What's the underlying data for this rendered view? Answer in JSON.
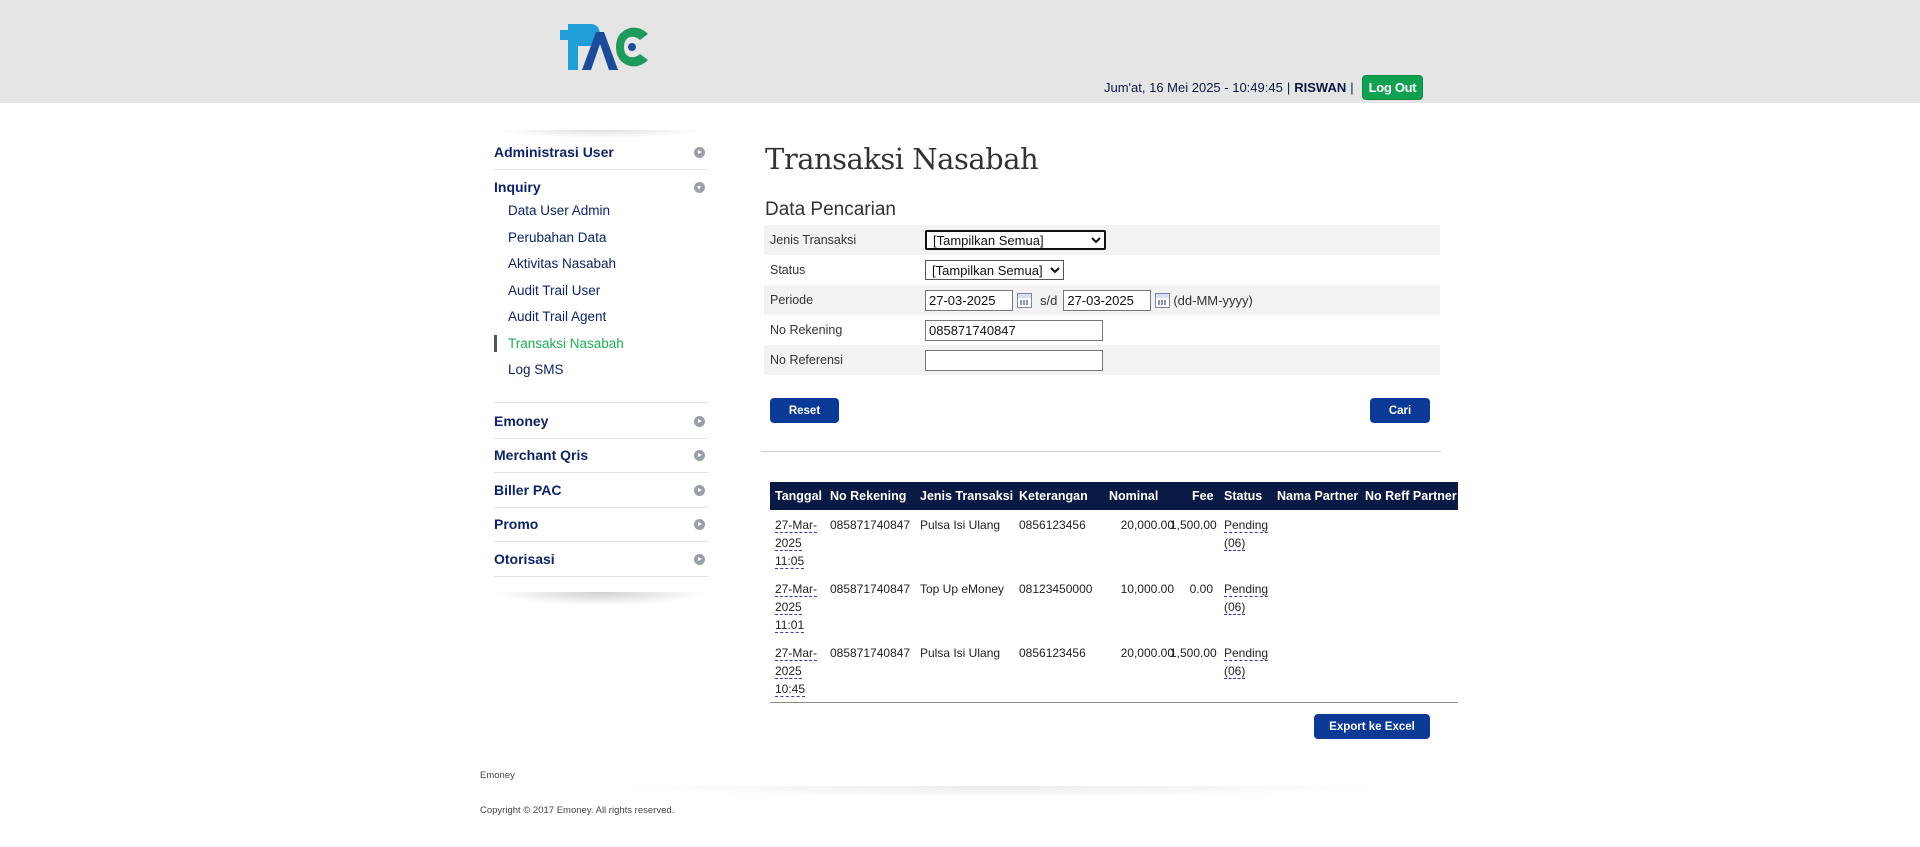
{
  "header": {
    "logo_text": "PAC",
    "datetime": "Jum'at, 16 Mei 2025 - 10:49:45",
    "user": "RISWAN",
    "separator": "|",
    "logout_label": "Log Out"
  },
  "sidebar": {
    "groups": [
      {
        "label": "Administrasi User",
        "expanded": false
      },
      {
        "label": "Inquiry",
        "expanded": true
      },
      {
        "label": "Emoney",
        "expanded": false
      },
      {
        "label": "Merchant Qris",
        "expanded": false
      },
      {
        "label": "Biller PAC",
        "expanded": false
      },
      {
        "label": "Promo",
        "expanded": false
      },
      {
        "label": "Otorisasi",
        "expanded": false
      }
    ],
    "inquiry_items": [
      {
        "label": "Data User Admin"
      },
      {
        "label": "Perubahan Data"
      },
      {
        "label": "Aktivitas Nasabah"
      },
      {
        "label": "Audit Trail User"
      },
      {
        "label": "Audit Trail Agent"
      },
      {
        "label": "Transaksi Nasabah",
        "active": true
      },
      {
        "label": "Log SMS"
      }
    ]
  },
  "main": {
    "title": "Transaksi Nasabah",
    "search_section": "Data Pencarian",
    "form": {
      "jenis_label": "Jenis Transaksi",
      "jenis_value": "[Tampilkan Semua]",
      "status_label": "Status",
      "status_value": "[Tampilkan Semua]",
      "periode_label": "Periode",
      "periode_from": "27-03-2025",
      "periode_sep": "s/d",
      "periode_to": "27-03-2025",
      "periode_format": "(dd-MM-yyyy)",
      "rekening_label": "No Rekening",
      "rekening_value": "085871740847",
      "referensi_label": "No Referensi",
      "referensi_value": ""
    },
    "reset_label": "Reset",
    "cari_label": "Cari",
    "table": {
      "headers": [
        "Tanggal",
        "No Rekening",
        "Jenis Transaksi",
        "Keterangan",
        "Nominal",
        "Fee",
        "Status",
        "Nama Partner",
        "No Reff Partner"
      ],
      "rows": [
        {
          "date": "27-Mar-",
          "year": "2025",
          "time": "11:05",
          "rekening": "085871740847",
          "jenis": "Pulsa Isi Ulang",
          "keterangan": "0856123456",
          "nominal": "20,000.00",
          "fee": "1,500.00",
          "status": "Pending",
          "status_code": "(06)",
          "partner": "",
          "reff": ""
        },
        {
          "date": "27-Mar-",
          "year": "2025",
          "time": "11:01",
          "rekening": "085871740847",
          "jenis": "Top Up eMoney",
          "keterangan": "08123450000",
          "nominal": "10,000.00",
          "fee": "0.00",
          "status": "Pending",
          "status_code": "(06)",
          "partner": "",
          "reff": ""
        },
        {
          "date": "27-Mar-",
          "year": "2025",
          "time": "10:45",
          "rekening": "085871740847",
          "jenis": "Pulsa Isi Ulang",
          "keterangan": "0856123456",
          "nominal": "20,000.00",
          "fee": "1,500.00",
          "status": "Pending",
          "status_code": "(06)",
          "partner": "",
          "reff": ""
        }
      ]
    },
    "export_label": "Export ke Excel"
  },
  "footer": {
    "label": "Emoney",
    "copyright": "Copyright © 2017 Emoney. All rights reserved."
  },
  "colors": {
    "header_bg": "#e6e5e5",
    "nav_text": "#0d2466",
    "active_item": "#1fae55",
    "button": "#0a3a96",
    "table_header": "#0a1a44",
    "logout": "#0fa14f"
  }
}
